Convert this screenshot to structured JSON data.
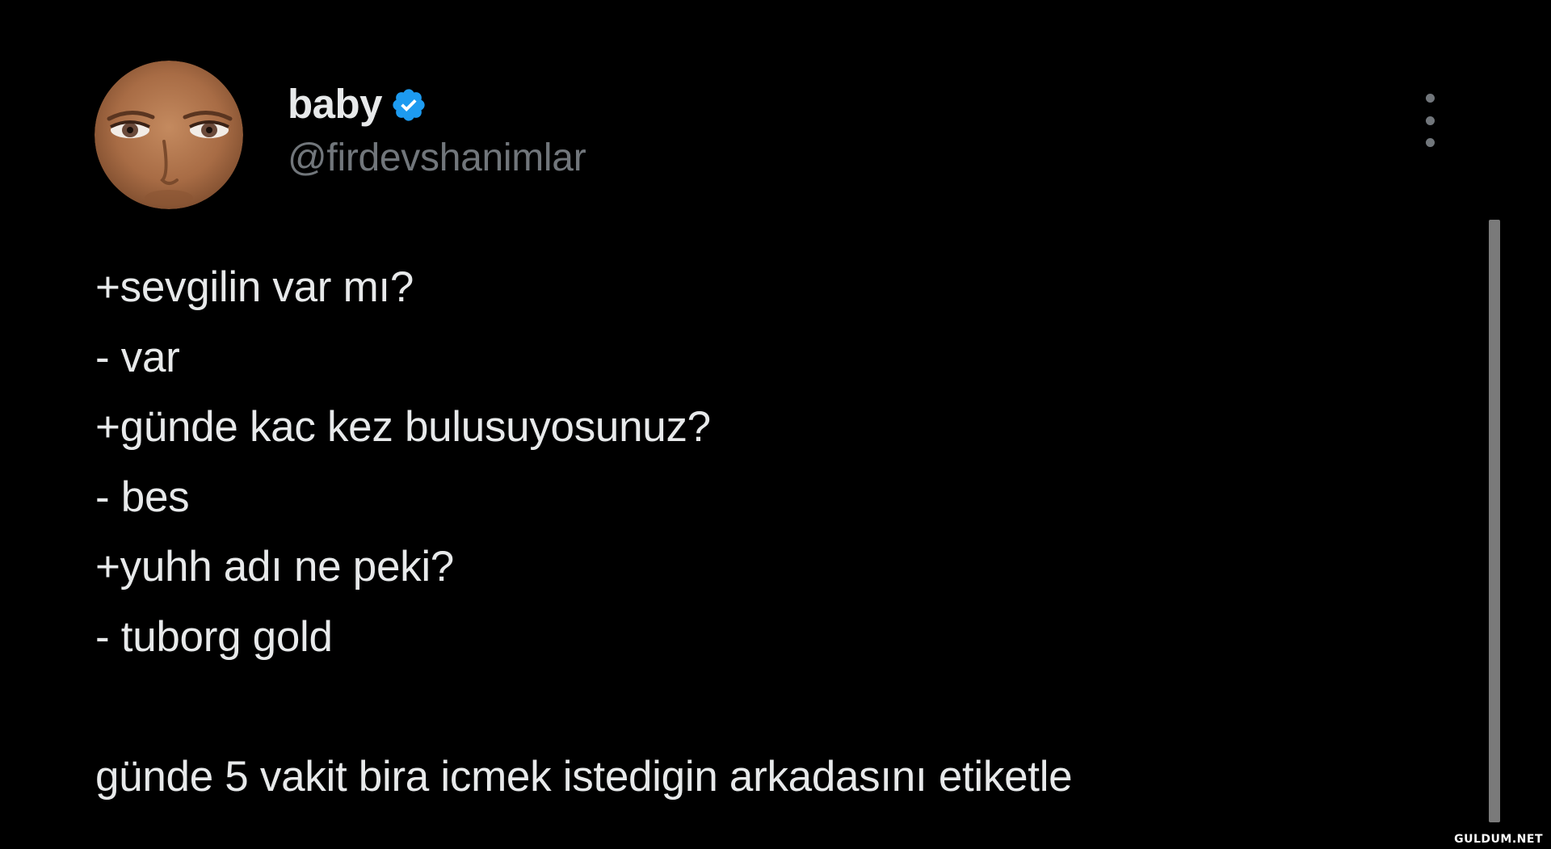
{
  "tweet": {
    "author": {
      "display_name": "baby",
      "handle": "@firdevshanimlar",
      "verified_icon": "verified-badge-icon",
      "verified_color": "#1d9bf0",
      "avatar_icon": "memoji-avatar"
    },
    "more_icon": "more-vertical-icon",
    "lines": [
      "+sevgilin var mı?",
      "- var",
      "+günde kac kez bulusuyosunuz?",
      "- bes",
      "+yuhh adı ne peki?",
      "- tuborg gold",
      "",
      "günde 5 vakit bira icmek istedigin arkadasını etiketle"
    ]
  },
  "watermark": "GULDUM.NET",
  "colors": {
    "background": "#000000",
    "primary_text": "#e7e9ea",
    "secondary_text": "#71767b",
    "scrollbar": "#7a7a7a"
  }
}
